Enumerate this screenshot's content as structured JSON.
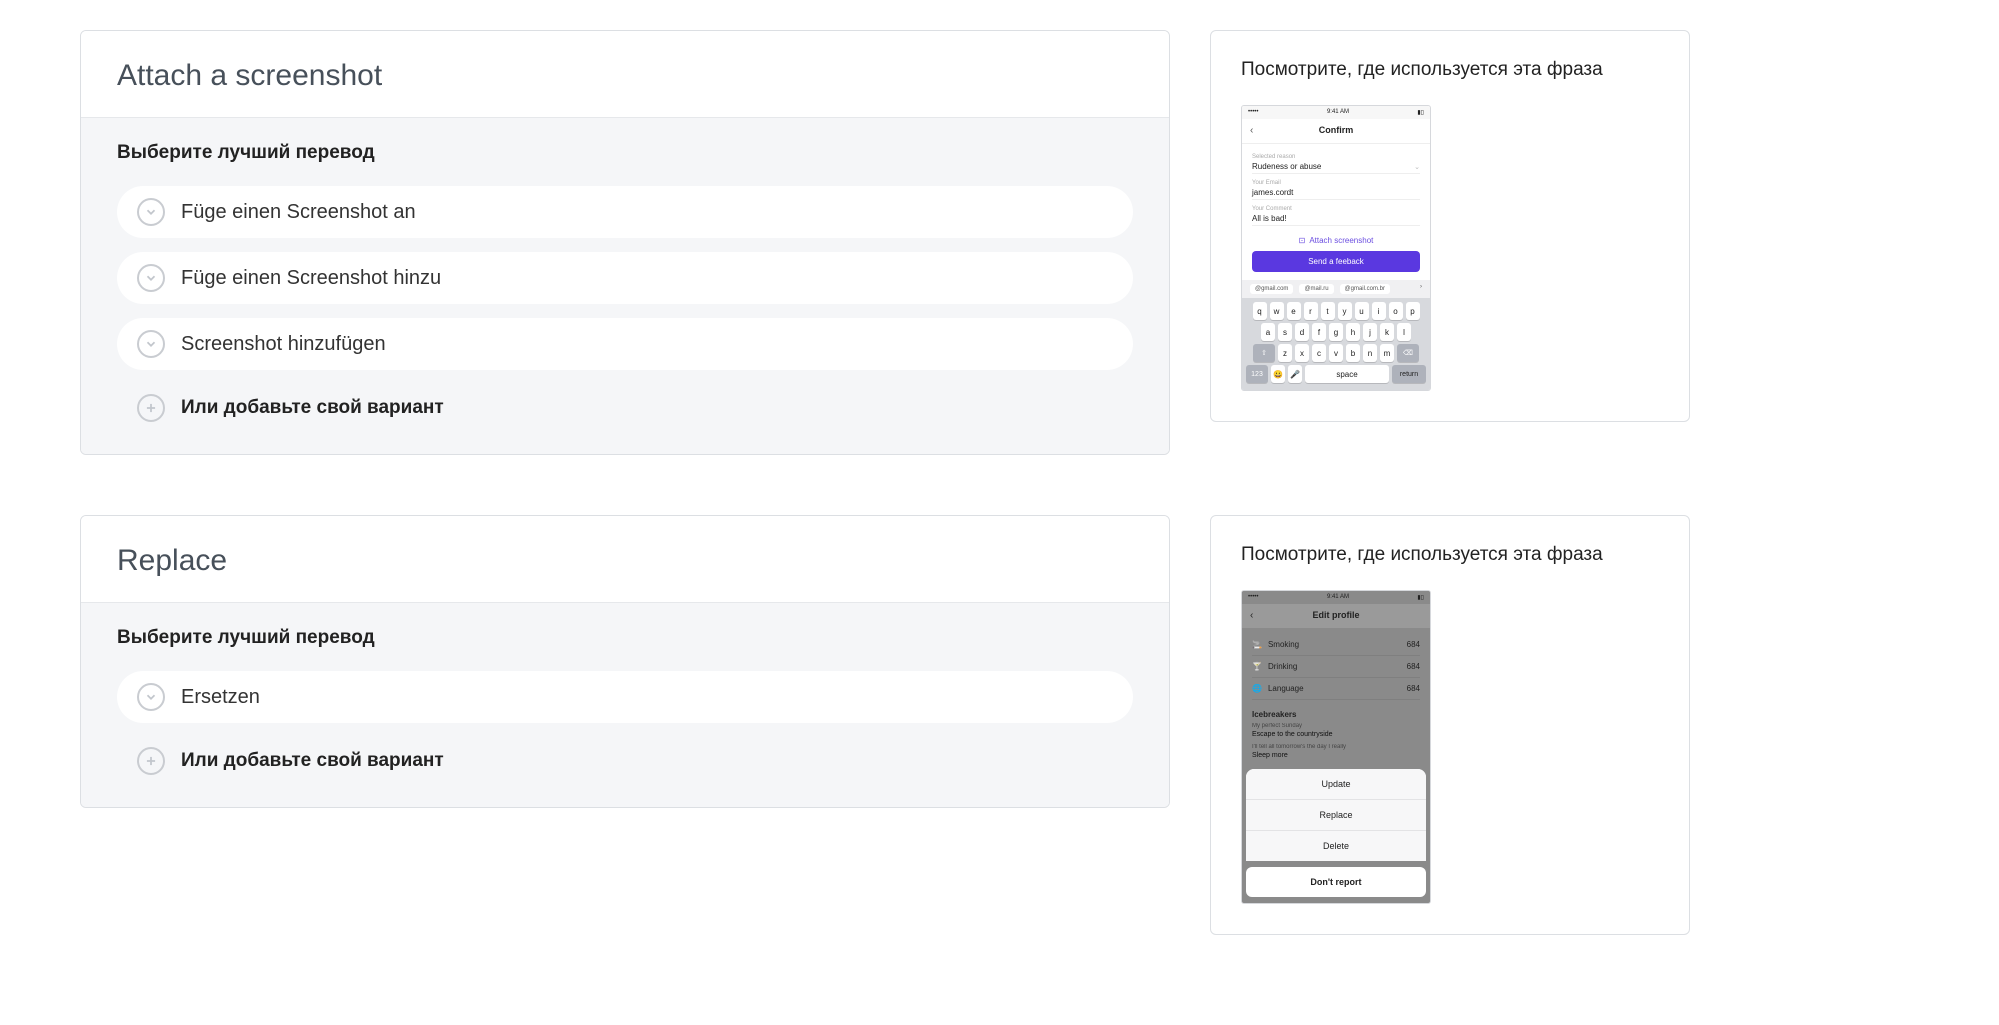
{
  "tasks": [
    {
      "title": "Attach a screenshot",
      "subheading": "Выберите лучший перевод",
      "options": [
        "Füge einen Screenshot an",
        "Füge einen Screenshot hinzu",
        "Screenshot hinzufügen"
      ],
      "add_label": "Или добавьте свой вариант",
      "context_title": "Посмотрите, где используется эта фраза",
      "mock": {
        "time": "9:41 AM",
        "nav_title": "Confirm",
        "fields": {
          "reason_label": "Selected reason",
          "reason_value": "Rudeness or abuse",
          "email_label": "Your Email",
          "email_value": "james.cordt",
          "comment_label": "Your Comment",
          "comment_value": "All is bad!"
        },
        "attach_label": "Attach screenshot",
        "send_label": "Send a feeback",
        "suggestions": [
          "@gmail.com",
          "@mail.ru",
          "@gmail.com.br"
        ],
        "kb_rows": [
          [
            "q",
            "w",
            "e",
            "r",
            "t",
            "y",
            "u",
            "i",
            "o",
            "p"
          ],
          [
            "a",
            "s",
            "d",
            "f",
            "g",
            "h",
            "j",
            "k",
            "l"
          ],
          [
            "⇧",
            "z",
            "x",
            "c",
            "v",
            "b",
            "n",
            "m",
            "⌫"
          ]
        ],
        "kb_bottom": {
          "num": "123",
          "emoji": "😀",
          "mic": "🎤",
          "space": "space",
          "return": "return"
        }
      }
    },
    {
      "title": "Replace",
      "subheading": "Выберите лучший перевод",
      "options": [
        "Ersetzen"
      ],
      "add_label": "Или добавьте свой вариант",
      "context_title": "Посмотрите, где используется эта фраза",
      "mock": {
        "time": "9:41 AM",
        "nav_title": "Edit profile",
        "list": [
          {
            "icon": "🚬",
            "label": "Smoking",
            "value": "684"
          },
          {
            "icon": "🍸",
            "label": "Drinking",
            "value": "684"
          },
          {
            "icon": "🌐",
            "label": "Language",
            "value": "684"
          }
        ],
        "section": "Icebreakers",
        "q1_label": "My perfect Sunday",
        "q1_value": "Escape to the countryside",
        "q2_label": "I'll tell all tomorrow's the day I really",
        "q2_value": "Sleep more",
        "actions": [
          "Update",
          "Replace",
          "Delete"
        ],
        "cancel": "Don't report"
      }
    }
  ]
}
